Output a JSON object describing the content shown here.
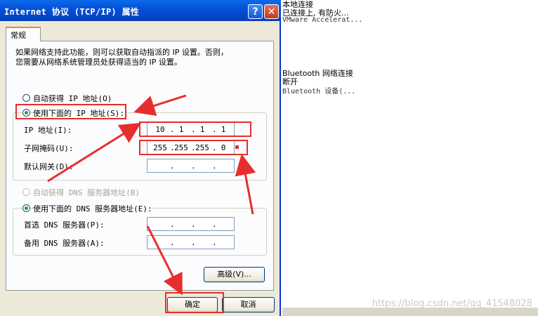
{
  "background": {
    "lines": [
      "本地连接",
      "已连接上, 有防火...",
      "VMware Accelerat...",
      "Bluetooth 网络连接",
      "断开",
      "Bluetooth 设备(..."
    ],
    "watermark": "https://blog.csdn.net/qq_41548028"
  },
  "dialog": {
    "title": "Internet 协议 (TCP/IP) 属性",
    "help_icon": "?",
    "close_icon": "✕",
    "tab": "常规",
    "description_line1": "如果网络支持此功能，则可以获取自动指派的 IP 设置。否则，",
    "description_line2": "您需要从网络系统管理员处获得适当的 IP 设置。",
    "ip_auto_label": "自动获得 IP 地址(O)",
    "ip_manual_label": "使用下面的 IP 地址(S):",
    "ip_address_label": "IP 地址(I):",
    "ip_address": [
      "10",
      "1",
      "1",
      "1"
    ],
    "subnet_label": "子网掩码(U):",
    "subnet_mask": [
      "255",
      "255",
      "255",
      "0"
    ],
    "gateway_label": "默认网关(D):",
    "gateway": [
      "",
      "",
      "",
      ""
    ],
    "dns_auto_label": "自动获得 DNS 服务器地址(B)",
    "dns_manual_label": "使用下面的 DNS 服务器地址(E):",
    "dns_preferred_label": "首选 DNS 服务器(P):",
    "dns_preferred": [
      "",
      "",
      "",
      ""
    ],
    "dns_alternate_label": "备用 DNS 服务器(A):",
    "dns_alternate": [
      "",
      "",
      "",
      ""
    ],
    "advanced_button": "高级(V)...",
    "ok_button": "确定",
    "cancel_button": "取消",
    "dot": "."
  },
  "colors": {
    "title_bar": "#0551d8",
    "dialog_bg": "#ece9d8",
    "annotation": "#e62e2e",
    "radio_dot": "#21a121"
  }
}
